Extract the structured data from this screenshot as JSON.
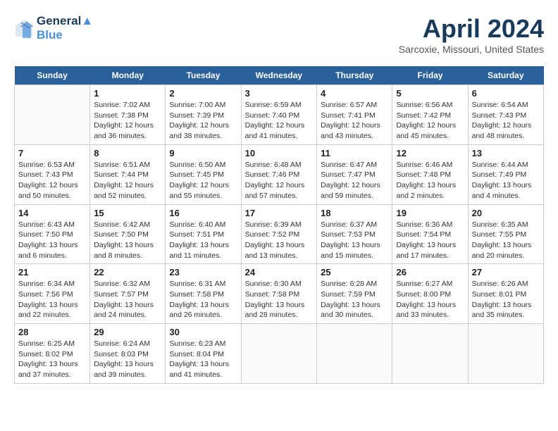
{
  "header": {
    "logo_line1": "General",
    "logo_line2": "Blue",
    "month": "April 2024",
    "location": "Sarcoxie, Missouri, United States"
  },
  "days_of_week": [
    "Sunday",
    "Monday",
    "Tuesday",
    "Wednesday",
    "Thursday",
    "Friday",
    "Saturday"
  ],
  "weeks": [
    [
      {
        "day": "",
        "content": ""
      },
      {
        "day": "1",
        "content": "Sunrise: 7:02 AM\nSunset: 7:38 PM\nDaylight: 12 hours\nand 36 minutes."
      },
      {
        "day": "2",
        "content": "Sunrise: 7:00 AM\nSunset: 7:39 PM\nDaylight: 12 hours\nand 38 minutes."
      },
      {
        "day": "3",
        "content": "Sunrise: 6:59 AM\nSunset: 7:40 PM\nDaylight: 12 hours\nand 41 minutes."
      },
      {
        "day": "4",
        "content": "Sunrise: 6:57 AM\nSunset: 7:41 PM\nDaylight: 12 hours\nand 43 minutes."
      },
      {
        "day": "5",
        "content": "Sunrise: 6:56 AM\nSunset: 7:42 PM\nDaylight: 12 hours\nand 45 minutes."
      },
      {
        "day": "6",
        "content": "Sunrise: 6:54 AM\nSunset: 7:43 PM\nDaylight: 12 hours\nand 48 minutes."
      }
    ],
    [
      {
        "day": "7",
        "content": "Sunrise: 6:53 AM\nSunset: 7:43 PM\nDaylight: 12 hours\nand 50 minutes."
      },
      {
        "day": "8",
        "content": "Sunrise: 6:51 AM\nSunset: 7:44 PM\nDaylight: 12 hours\nand 52 minutes."
      },
      {
        "day": "9",
        "content": "Sunrise: 6:50 AM\nSunset: 7:45 PM\nDaylight: 12 hours\nand 55 minutes."
      },
      {
        "day": "10",
        "content": "Sunrise: 6:48 AM\nSunset: 7:46 PM\nDaylight: 12 hours\nand 57 minutes."
      },
      {
        "day": "11",
        "content": "Sunrise: 6:47 AM\nSunset: 7:47 PM\nDaylight: 12 hours\nand 59 minutes."
      },
      {
        "day": "12",
        "content": "Sunrise: 6:46 AM\nSunset: 7:48 PM\nDaylight: 13 hours\nand 2 minutes."
      },
      {
        "day": "13",
        "content": "Sunrise: 6:44 AM\nSunset: 7:49 PM\nDaylight: 13 hours\nand 4 minutes."
      }
    ],
    [
      {
        "day": "14",
        "content": "Sunrise: 6:43 AM\nSunset: 7:50 PM\nDaylight: 13 hours\nand 6 minutes."
      },
      {
        "day": "15",
        "content": "Sunrise: 6:42 AM\nSunset: 7:50 PM\nDaylight: 13 hours\nand 8 minutes."
      },
      {
        "day": "16",
        "content": "Sunrise: 6:40 AM\nSunset: 7:51 PM\nDaylight: 13 hours\nand 11 minutes."
      },
      {
        "day": "17",
        "content": "Sunrise: 6:39 AM\nSunset: 7:52 PM\nDaylight: 13 hours\nand 13 minutes."
      },
      {
        "day": "18",
        "content": "Sunrise: 6:37 AM\nSunset: 7:53 PM\nDaylight: 13 hours\nand 15 minutes."
      },
      {
        "day": "19",
        "content": "Sunrise: 6:36 AM\nSunset: 7:54 PM\nDaylight: 13 hours\nand 17 minutes."
      },
      {
        "day": "20",
        "content": "Sunrise: 6:35 AM\nSunset: 7:55 PM\nDaylight: 13 hours\nand 20 minutes."
      }
    ],
    [
      {
        "day": "21",
        "content": "Sunrise: 6:34 AM\nSunset: 7:56 PM\nDaylight: 13 hours\nand 22 minutes."
      },
      {
        "day": "22",
        "content": "Sunrise: 6:32 AM\nSunset: 7:57 PM\nDaylight: 13 hours\nand 24 minutes."
      },
      {
        "day": "23",
        "content": "Sunrise: 6:31 AM\nSunset: 7:58 PM\nDaylight: 13 hours\nand 26 minutes."
      },
      {
        "day": "24",
        "content": "Sunrise: 6:30 AM\nSunset: 7:58 PM\nDaylight: 13 hours\nand 28 minutes."
      },
      {
        "day": "25",
        "content": "Sunrise: 6:28 AM\nSunset: 7:59 PM\nDaylight: 13 hours\nand 30 minutes."
      },
      {
        "day": "26",
        "content": "Sunrise: 6:27 AM\nSunset: 8:00 PM\nDaylight: 13 hours\nand 33 minutes."
      },
      {
        "day": "27",
        "content": "Sunrise: 6:26 AM\nSunset: 8:01 PM\nDaylight: 13 hours\nand 35 minutes."
      }
    ],
    [
      {
        "day": "28",
        "content": "Sunrise: 6:25 AM\nSunset: 8:02 PM\nDaylight: 13 hours\nand 37 minutes."
      },
      {
        "day": "29",
        "content": "Sunrise: 6:24 AM\nSunset: 8:03 PM\nDaylight: 13 hours\nand 39 minutes."
      },
      {
        "day": "30",
        "content": "Sunrise: 6:23 AM\nSunset: 8:04 PM\nDaylight: 13 hours\nand 41 minutes."
      },
      {
        "day": "",
        "content": ""
      },
      {
        "day": "",
        "content": ""
      },
      {
        "day": "",
        "content": ""
      },
      {
        "day": "",
        "content": ""
      }
    ]
  ]
}
